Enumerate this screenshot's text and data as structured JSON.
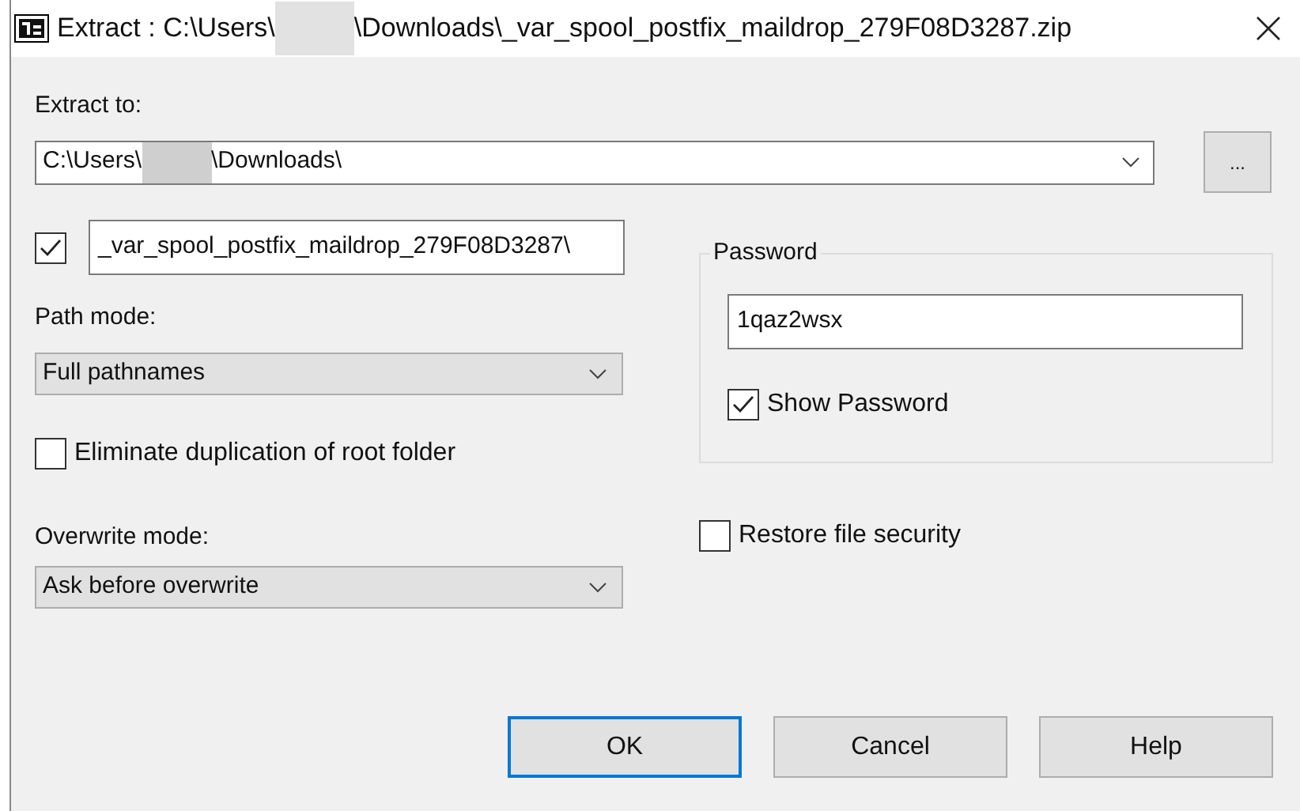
{
  "window": {
    "title_before": "Extract : C:\\Users\\",
    "title_after": "\\Downloads\\_var_spool_postfix_maildrop_279F08D3287.zip"
  },
  "extract_to": {
    "label": "Extract to:",
    "value_before": "C:\\Users\\",
    "value_after": "\\Downloads\\",
    "browse_button": "..."
  },
  "folder_name": {
    "checked": true,
    "value": "_var_spool_postfix_maildrop_279F08D3287\\"
  },
  "path_mode": {
    "label": "Path mode:",
    "value": "Full pathnames"
  },
  "eliminate_duplication": {
    "label": "Eliminate duplication of root folder",
    "checked": false
  },
  "overwrite_mode": {
    "label": "Overwrite mode:",
    "value": "Ask before overwrite"
  },
  "password": {
    "group_label": "Password",
    "value": "1qaz2wsx",
    "show_password": {
      "label": "Show Password",
      "checked": true
    }
  },
  "restore_file_security": {
    "label": "Restore file security",
    "checked": false
  },
  "buttons": [
    {
      "label": "OK",
      "default": true
    },
    {
      "label": "Cancel",
      "default": false
    },
    {
      "label": "Help",
      "default": false
    }
  ]
}
